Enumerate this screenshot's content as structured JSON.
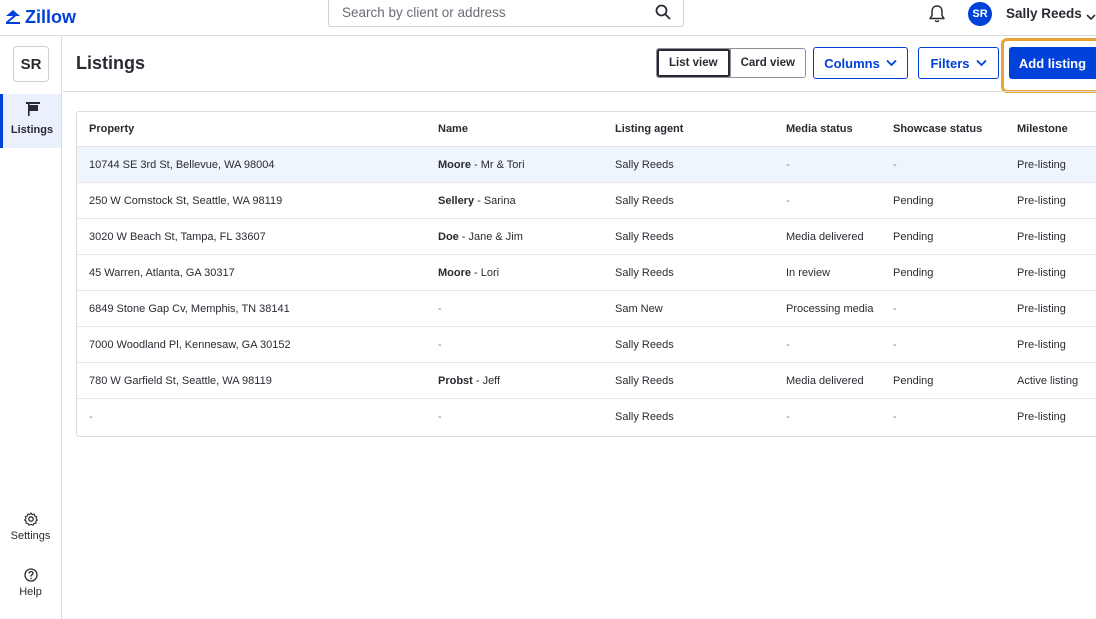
{
  "app": {
    "logo_text": "Zillow",
    "brand_color": "#0041d9",
    "highlight_color": "#e8a338"
  },
  "search": {
    "placeholder": "Search by client or address"
  },
  "user": {
    "initials": "SR",
    "name": "Sally Reeds"
  },
  "rail": {
    "avatar": "SR",
    "items": [
      {
        "label": "Listings",
        "icon": "flag-icon",
        "active": true
      },
      {
        "label": "Settings",
        "icon": "gear-icon"
      },
      {
        "label": "Help",
        "icon": "help-icon"
      }
    ]
  },
  "page": {
    "title": "Listings"
  },
  "toolbar": {
    "views": [
      "List view",
      "Card view"
    ],
    "active_view": "List view",
    "columns_label": "Columns",
    "filters_label": "Filters",
    "add_label": "Add listing"
  },
  "table": {
    "columns": [
      "Property",
      "Name",
      "Listing agent",
      "Media status",
      "Showcase status",
      "Milestone"
    ],
    "rows": [
      {
        "property": "10744 SE 3rd St, Bellevue, WA 98004",
        "name_last": "Moore",
        "name_first": " - Mr & Tori",
        "agent": "Sally Reeds",
        "media": "-",
        "showcase": "-",
        "milestone": "Pre-listing",
        "selected": true
      },
      {
        "property": "250 W Comstock St, Seattle, WA 98119",
        "name_last": "Sellery",
        "name_first": " - Sarina",
        "agent": "Sally Reeds",
        "media": "-",
        "showcase": "Pending",
        "milestone": "Pre-listing"
      },
      {
        "property": "3020 W Beach St, Tampa, FL 33607",
        "name_last": "Doe",
        "name_first": " - Jane & Jim",
        "agent": "Sally Reeds",
        "media": "Media delivered",
        "showcase": "Pending",
        "milestone": "Pre-listing"
      },
      {
        "property": "45 Warren, Atlanta, GA 30317",
        "name_last": "Moore",
        "name_first": " - Lori",
        "agent": "Sally Reeds",
        "media": "In review",
        "showcase": "Pending",
        "milestone": "Pre-listing"
      },
      {
        "property": "6849 Stone Gap Cv, Memphis, TN 38141",
        "name_last": "",
        "name_first": "-",
        "agent": "Sam New",
        "media": "Processing media",
        "showcase": "-",
        "milestone": "Pre-listing"
      },
      {
        "property": "7000 Woodland Pl, Kennesaw, GA 30152",
        "name_last": "",
        "name_first": "-",
        "agent": "Sally Reeds",
        "media": "-",
        "showcase": "-",
        "milestone": "Pre-listing"
      },
      {
        "property": "780 W Garfield St, Seattle, WA 98119",
        "name_last": "Probst",
        "name_first": " - Jeff",
        "agent": "Sally Reeds",
        "media": "Media delivered",
        "showcase": "Pending",
        "milestone": "Active listing"
      },
      {
        "property": "-",
        "name_last": "",
        "name_first": "-",
        "agent": "Sally Reeds",
        "media": "-",
        "showcase": "-",
        "milestone": "Pre-listing"
      }
    ]
  }
}
